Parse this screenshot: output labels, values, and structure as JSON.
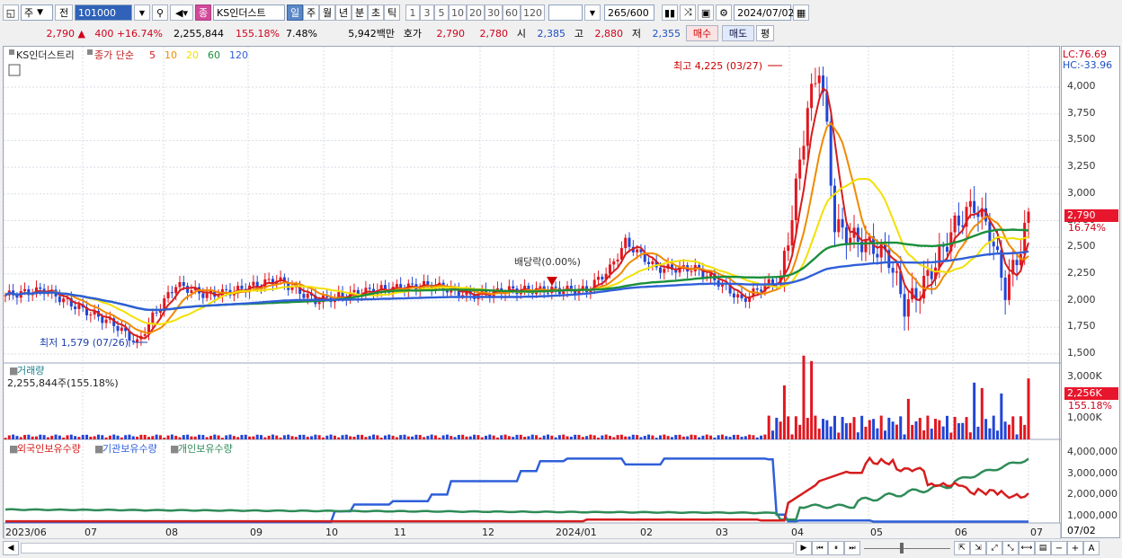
{
  "toolbar": {
    "type_select": "주",
    "prev_label": "전",
    "code": "101000",
    "stock_badge": "종",
    "stock_name": "KS인더스트",
    "periods": [
      "일",
      "주",
      "월",
      "년",
      "분",
      "초",
      "틱"
    ],
    "active_period": "일",
    "intervals": [
      "1",
      "3",
      "5",
      "10",
      "20",
      "30",
      "60",
      "120"
    ],
    "count": "265",
    "count_total": "/600",
    "date": "2024/07/02"
  },
  "quote": {
    "price": "2,790",
    "arrow": "▲",
    "change": "400",
    "change_pct": "+16.74%",
    "volume": "2,255,844",
    "vol_ratio": "155.18%",
    "turnover": "7.48%",
    "amount": "5,942백만",
    "hoga_label": "호가",
    "ask": "2,790",
    "bid": "2,780",
    "open_label": "시",
    "open": "2,385",
    "high_label": "고",
    "high": "2,880",
    "low_label": "저",
    "low": "2,355",
    "buy_label": "매수",
    "sell_label": "매도",
    "eval_label": "평"
  },
  "price_panel": {
    "stock_label": "KS인더스트리",
    "series_title": "종가 단순",
    "ma_labels": [
      "5",
      "10",
      "20",
      "60",
      "120"
    ],
    "ma_colors": [
      "#d61d1d",
      "#f08a00",
      "#f2e000",
      "#1a8f3a",
      "#2f5fd8"
    ],
    "lc": "LC:76.69",
    "hc": "HC:-33.96",
    "high_note": "최고 4,225 (03/27)",
    "low_note": "최저 1,579 (07/26)",
    "div_note": "배당락(0.00%)",
    "price_tag": "2,790",
    "pct_tag": "16.74%",
    "y_ticks": [
      "4,000",
      "3,750",
      "3,500",
      "3,250",
      "3,000",
      "2,750",
      "2,500",
      "2,250",
      "2,000",
      "1,750",
      "1,500"
    ]
  },
  "volume_panel": {
    "title": "거래량",
    "value": "2,255,844주(155.18%)",
    "tag": "2,256K",
    "pct": "155.18%",
    "y_ticks": [
      "3,000K",
      "2,000K",
      "1,000K"
    ]
  },
  "holding_panel": {
    "legend": [
      "외국인보유수량",
      "기관보유수량",
      "개인보유수량"
    ],
    "legend_colors": [
      "#d61d1d",
      "#2f5fd8",
      "#2e8b57"
    ],
    "y_ticks": [
      "4,000,000",
      "3,000,000",
      "2,000,000",
      "1,000,000"
    ]
  },
  "x_axis": {
    "labels": [
      "2023/06",
      "07",
      "08",
      "09",
      "10",
      "11",
      "12",
      "2024/01",
      "02",
      "03",
      "04",
      "05",
      "06",
      "07"
    ],
    "right_label": "07/02"
  }
}
